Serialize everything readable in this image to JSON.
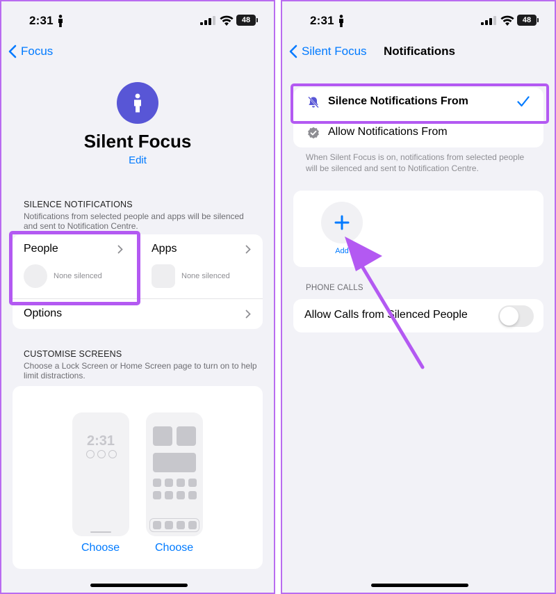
{
  "colors": {
    "accent": "#007aff",
    "highlight": "#b359f2",
    "focus_icon_bg": "#5856d6"
  },
  "status_bar": {
    "time": "2:31",
    "battery": "48"
  },
  "left": {
    "back_label": "Focus",
    "focus_name": "Silent Focus",
    "edit_label": "Edit",
    "silence_section_title": "SILENCE NOTIFICATIONS",
    "silence_section_desc": "Notifications from selected people and apps will be silenced and sent to Notification Centre.",
    "people_label": "People",
    "people_status": "None silenced",
    "apps_label": "Apps",
    "apps_status": "None silenced",
    "options_label": "Options",
    "customise_title": "CUSTOMISE SCREENS",
    "customise_desc": "Choose a Lock Screen or Home Screen page to turn on to help limit distractions.",
    "lock_preview_time": "2:31",
    "choose_lock": "Choose",
    "choose_home": "Choose"
  },
  "right": {
    "back_label": "Silent Focus",
    "title": "Notifications",
    "silence_from": "Silence Notifications From",
    "allow_from": "Allow Notifications From",
    "selected_option": "Silence Notifications From",
    "note": "When Silent Focus is on, notifications from selected people will be silenced and sent to Notification Centre.",
    "add_label": "Add",
    "phone_calls_title": "PHONE CALLS",
    "allow_calls_label": "Allow Calls from Silenced People",
    "allow_calls_enabled": false
  }
}
